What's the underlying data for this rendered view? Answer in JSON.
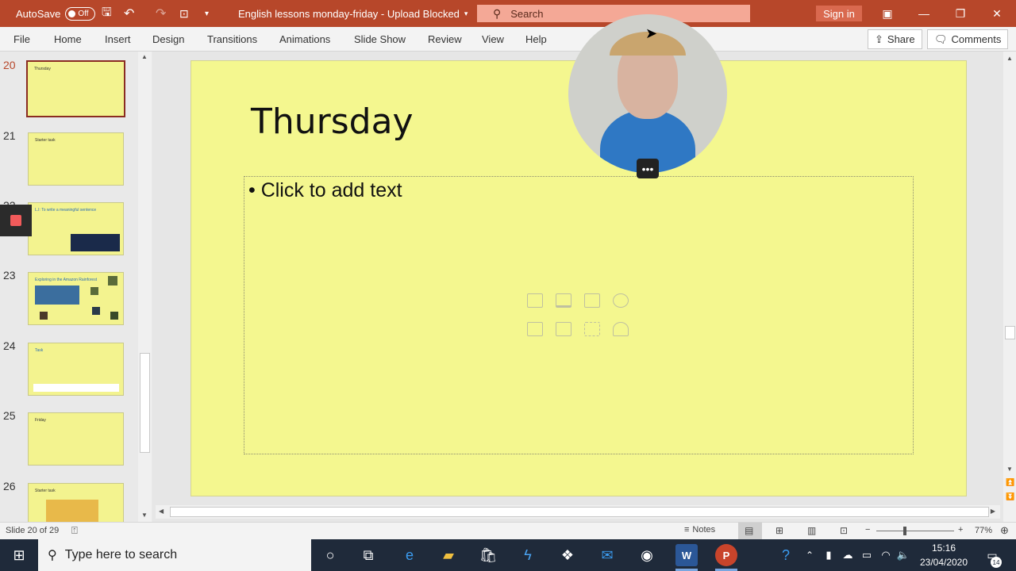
{
  "titlebar": {
    "autosave_label": "AutoSave",
    "autosave_state": "Off",
    "doc_title": "English lessons monday-friday - Upload Blocked",
    "search_placeholder": "Search",
    "signin_label": "Sign in"
  },
  "menu": {
    "items": [
      "File",
      "Home",
      "Insert",
      "Design",
      "Transitions",
      "Animations",
      "Slide Show",
      "Review",
      "View",
      "Help"
    ],
    "share_label": "Share",
    "comments_label": "Comments"
  },
  "thumbnails": [
    {
      "num": "20",
      "text": "Thursday",
      "selected": true
    },
    {
      "num": "21",
      "text": "Starter task",
      "selected": false
    },
    {
      "num": "22",
      "text": "L.I: To write a meaningful sentence",
      "selected": false
    },
    {
      "num": "23",
      "text": "Exploring in the Amazon Rainforest",
      "selected": false
    },
    {
      "num": "24",
      "text": "Task",
      "selected": false
    },
    {
      "num": "25",
      "text": "Friday",
      "selected": false
    },
    {
      "num": "26",
      "text": "Starter task",
      "selected": false
    }
  ],
  "slide": {
    "title": "Thursday",
    "placeholder_text": "• Click to add text"
  },
  "status": {
    "slide_count": "Slide 20 of 29",
    "notes_label": "Notes",
    "zoom": "77%"
  },
  "taskbar": {
    "search_placeholder": "Type here to search",
    "time": "15:16",
    "date": "23/04/2020",
    "notif_count": "14"
  }
}
